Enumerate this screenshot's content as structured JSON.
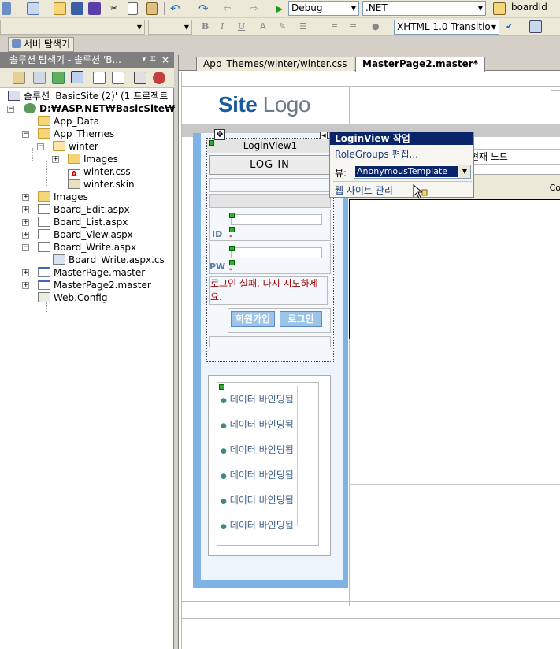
{
  "toolbar1": {
    "config_value": "Debug",
    "platform_value": ".NET",
    "find_value": "boardId"
  },
  "toolbar2": {
    "bold": "B",
    "italic": "I",
    "underline": "U",
    "doctype_value": "XHTML 1.0 Transitio"
  },
  "server_explorer_tab": "서버 탐색기",
  "solution_panel": {
    "title": "솔루션 탐색기 - 솔루션 'B...",
    "tree": [
      {
        "label": "솔루션 'BasicSite (2)' (1 프로젝트",
        "icon": "solution-icon"
      },
      {
        "label": "D:₩ASP.NET₩BasicSite₩",
        "icon": "project-icon"
      },
      {
        "label": "App_Data",
        "icon": "folder-icon"
      },
      {
        "label": "App_Themes",
        "icon": "folder-icon"
      },
      {
        "label": "winter",
        "icon": "folder-icon"
      },
      {
        "label": "Images",
        "icon": "folder-icon"
      },
      {
        "label": "winter.css",
        "icon": "css-file-icon"
      },
      {
        "label": "winter.skin",
        "icon": "skin-file-icon"
      },
      {
        "label": "Images",
        "icon": "folder-icon"
      },
      {
        "label": "Board_Edit.aspx",
        "icon": "aspx-file-icon"
      },
      {
        "label": "Board_List.aspx",
        "icon": "aspx-file-icon"
      },
      {
        "label": "Board_View.aspx",
        "icon": "aspx-file-icon"
      },
      {
        "label": "Board_Write.aspx",
        "icon": "aspx-file-icon"
      },
      {
        "label": "Board_Write.aspx.cs",
        "icon": "cs-file-icon"
      },
      {
        "label": "MasterPage.master",
        "icon": "master-file-icon"
      },
      {
        "label": "MasterPage2.master",
        "icon": "master-file-icon"
      },
      {
        "label": "Web.Config",
        "icon": "config-file-icon"
      }
    ]
  },
  "doc_tabs": [
    {
      "label": "App_Themes/winter/winter.css"
    },
    {
      "label": "MasterPage2.master*"
    }
  ],
  "design": {
    "logo_bold": "Site",
    "logo_light": " Logo",
    "loginview_label": "LoginView1",
    "login_header": "LOG IN",
    "id_label": "ID",
    "pw_label": "PW",
    "fail_text": "로그인 실패. 다시 시도하세요.",
    "join_button": "회원가입",
    "login_button": "로그인",
    "bound_items": [
      "데이터 바인딩됨",
      "데이터 바인딩됨",
      "데이터 바인딩됨",
      "데이터 바인딩됨",
      "데이터 바인딩됨",
      "데이터 바인딩됨"
    ],
    "current_node": "현재 노드",
    "co_text": "Co"
  },
  "smart_tag": {
    "title": "LoginView 작업",
    "rolegroups": "RoleGroups 편집...",
    "view_label": "뷰:",
    "view_value": "AnonymousTemplate",
    "website_admin": "웹 사이트 관리"
  },
  "colors": {
    "accent_blue": "#0a246a",
    "frame_blue": "#7fb2e5",
    "logo_blue": "#1a5a9e",
    "error_red": "#a00000"
  }
}
